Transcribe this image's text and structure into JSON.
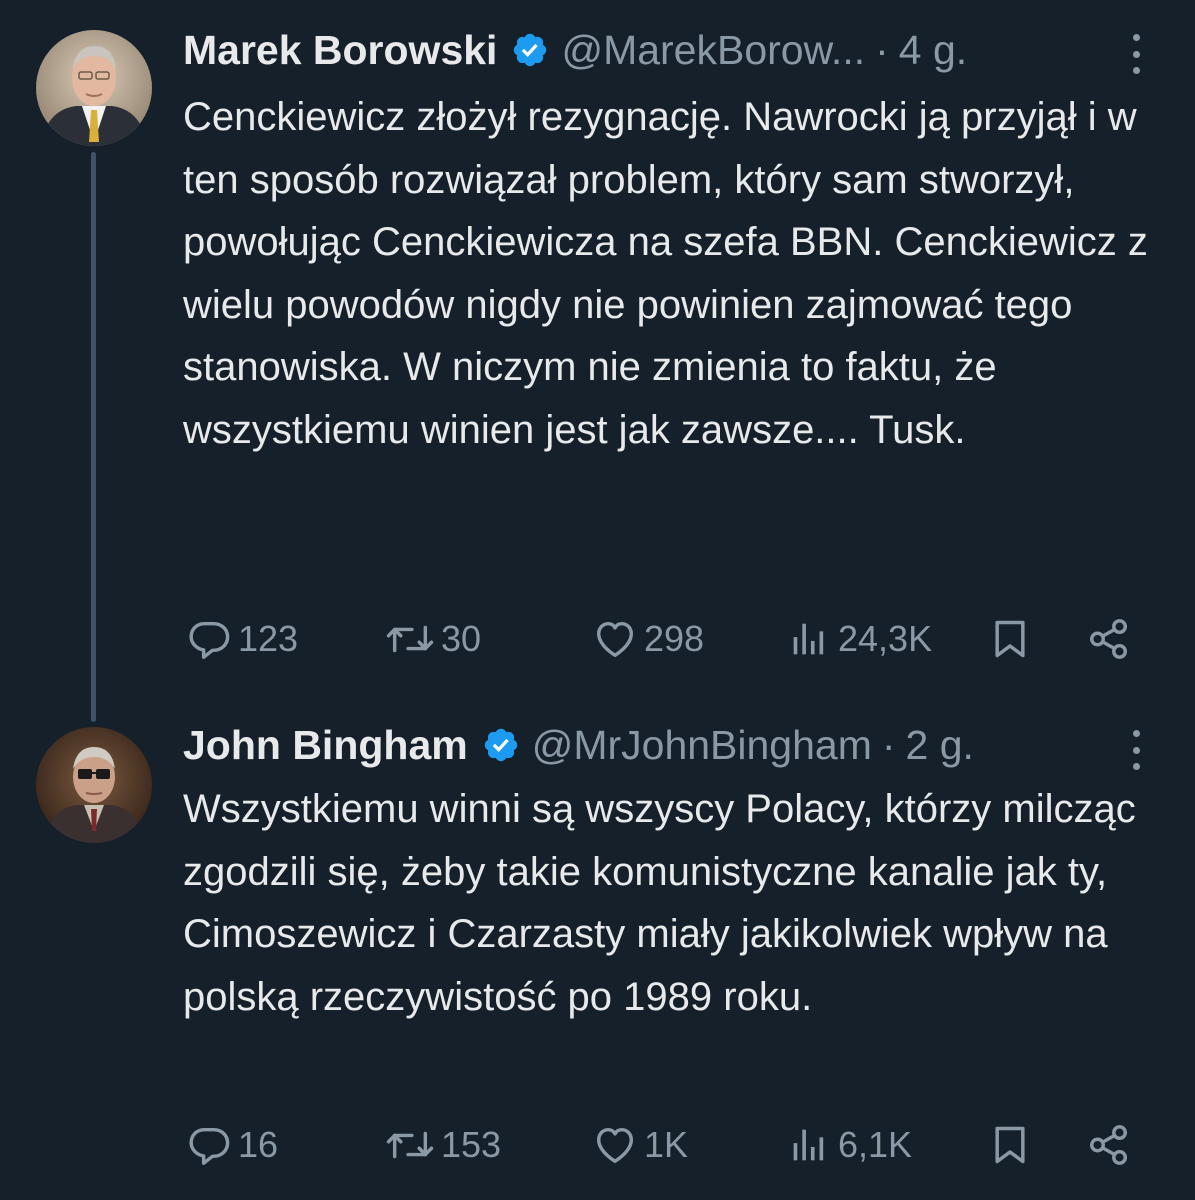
{
  "tweets": [
    {
      "author_name": "Marek Borowski",
      "handle": "@MarekBorow...",
      "separator": "·",
      "time": "4 g.",
      "text": "Cenckiewicz złożył rezygnację. Nawrocki ją przyjął i w ten sposób rozwiązał problem, który sam stworzył, powołując Cenckiewicza na szefa BBN. Cenckiewicz z wielu powodów nigdy nie powinien zajmować tego stanowiska. W niczym nie zmienia to faktu, że wszystkiemu winien jest jak zawsze.... Tusk.",
      "replies": "123",
      "retweets": "30",
      "likes": "298",
      "views": "24,3K"
    },
    {
      "author_name": "John Bingham",
      "handle": "@MrJohnBingham",
      "separator": "·",
      "time": "2 g.",
      "text": "Wszystkiemu winni są wszyscy Polacy, którzy milcząc zgodzili się, żeby takie komunistyczne kanalie jak ty, Cimoszewicz i Czarzasty miały jakikolwiek wpływ na polską rzeczywistość po 1989 roku.",
      "replies": "16",
      "retweets": "153",
      "likes": "1K",
      "views": "6,1K"
    }
  ],
  "icons": {
    "verified": "verified-badge-icon",
    "reply": "reply-icon",
    "retweet": "retweet-icon",
    "like": "heart-icon",
    "views": "analytics-icon",
    "bookmark": "bookmark-icon",
    "share": "share-icon",
    "more": "more-options-icon"
  },
  "colors": {
    "background": "#15202b",
    "text": "#e7e9ea",
    "muted": "#8b98a5",
    "verified": "#1d9bf0",
    "thread_line": "#3d5466"
  }
}
